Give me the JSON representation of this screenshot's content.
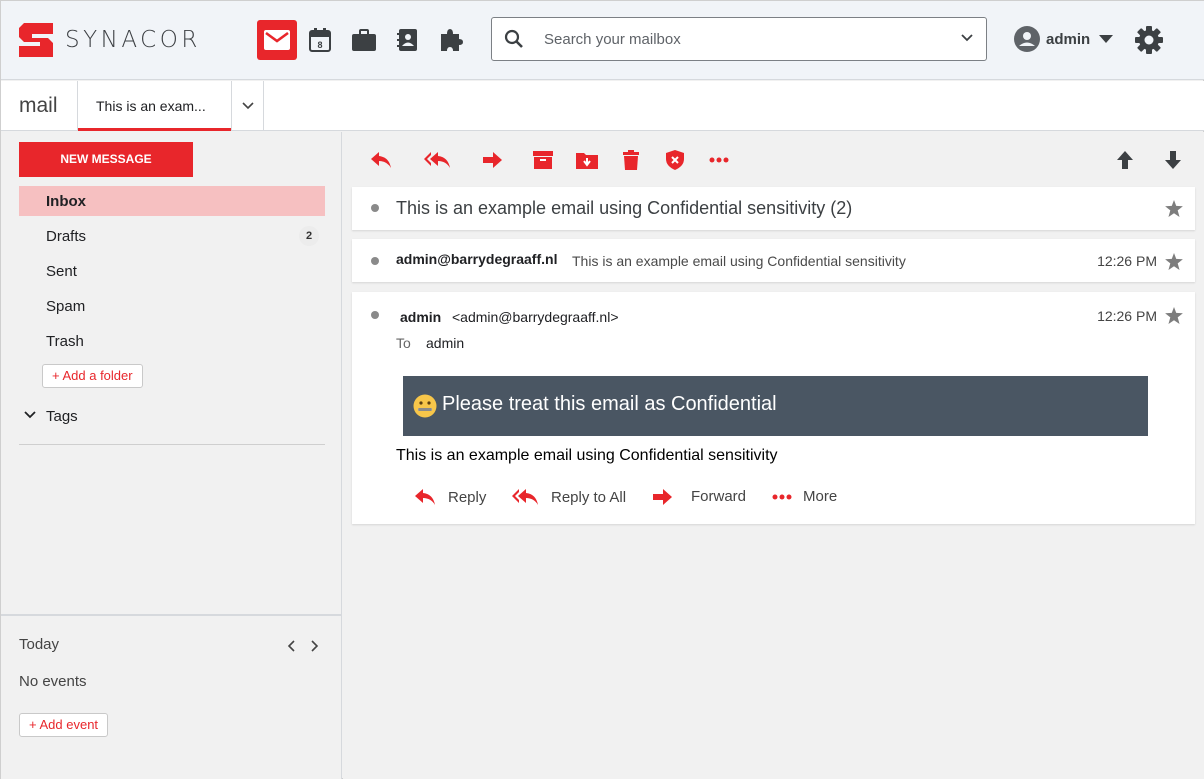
{
  "header": {
    "brand": "SYNACOR",
    "apps": [
      {
        "name": "mail",
        "icon": "mail-icon"
      },
      {
        "name": "calendar",
        "icon": "calendar-icon",
        "day": "8"
      },
      {
        "name": "briefcase",
        "icon": "briefcase-icon"
      },
      {
        "name": "contacts",
        "icon": "contacts-icon"
      },
      {
        "name": "integrations",
        "icon": "puzzle-icon"
      }
    ],
    "search_placeholder": "Search your mailbox",
    "user": "admin"
  },
  "tabbar": {
    "app_title": "mail",
    "tab_label": "This is an exam..."
  },
  "sidebar": {
    "new_message": "NEW MESSAGE",
    "folders": [
      {
        "label": "Inbox",
        "count": null,
        "active": true
      },
      {
        "label": "Drafts",
        "count": "2",
        "active": false
      },
      {
        "label": "Sent",
        "count": null,
        "active": false
      },
      {
        "label": "Spam",
        "count": null,
        "active": false
      },
      {
        "label": "Trash",
        "count": null,
        "active": false
      }
    ],
    "add_folder": "+ Add a folder",
    "tags": "Tags",
    "calendar": {
      "today": "Today",
      "no_events": "No events",
      "add_event": "+ Add event"
    }
  },
  "toolbar": {
    "actions": [
      "reply-icon",
      "reply-all-icon",
      "forward-icon",
      "archive-icon",
      "move-folder-icon",
      "delete-icon",
      "spam-shield-icon",
      "more-icon"
    ],
    "nav": [
      "arrow-up-icon",
      "arrow-down-icon"
    ]
  },
  "conversation": {
    "subject": "This is an example email using Confidential sensitivity (2)",
    "collapsed": {
      "from": "admin@barrydegraaff.nl",
      "snippet": "This is an example email using Confidential sensitivity",
      "time": "12:26 PM"
    },
    "expanded": {
      "from_name": "admin",
      "from_addr": "<admin@barrydegraaff.nl>",
      "time": "12:26 PM",
      "to_label": "To",
      "to_value": "admin",
      "banner": "Please treat this email as Confidential",
      "body": "This is an example email using Confidential sensitivity",
      "actions": {
        "reply": "Reply",
        "reply_all": "Reply to All",
        "forward": "Forward",
        "more": "More"
      }
    }
  },
  "colors": {
    "accent": "#e8262b",
    "banner_bg": "#4a5663",
    "active_folder_bg": "#f6c0c1"
  }
}
